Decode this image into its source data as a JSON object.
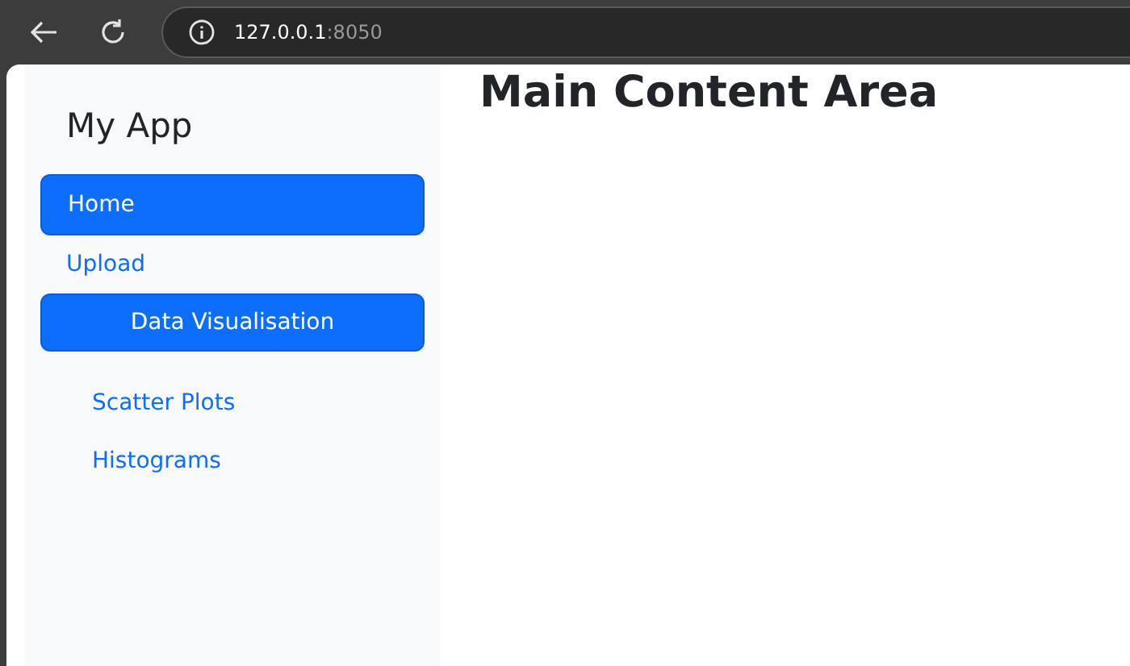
{
  "browser": {
    "address": {
      "host": "127.0.0.1",
      "port": ":8050"
    }
  },
  "sidebar": {
    "title": "My App",
    "items": [
      {
        "kind": "link",
        "label": "Home",
        "selected": true
      },
      {
        "kind": "link",
        "label": "Upload",
        "selected": false
      },
      {
        "kind": "group",
        "label": "Data Visualisation",
        "children": [
          {
            "label": "Scatter Plots",
            "selected": false
          },
          {
            "label": "Histograms",
            "selected": false
          }
        ]
      }
    ]
  },
  "main": {
    "heading": "Main Content Area"
  }
}
